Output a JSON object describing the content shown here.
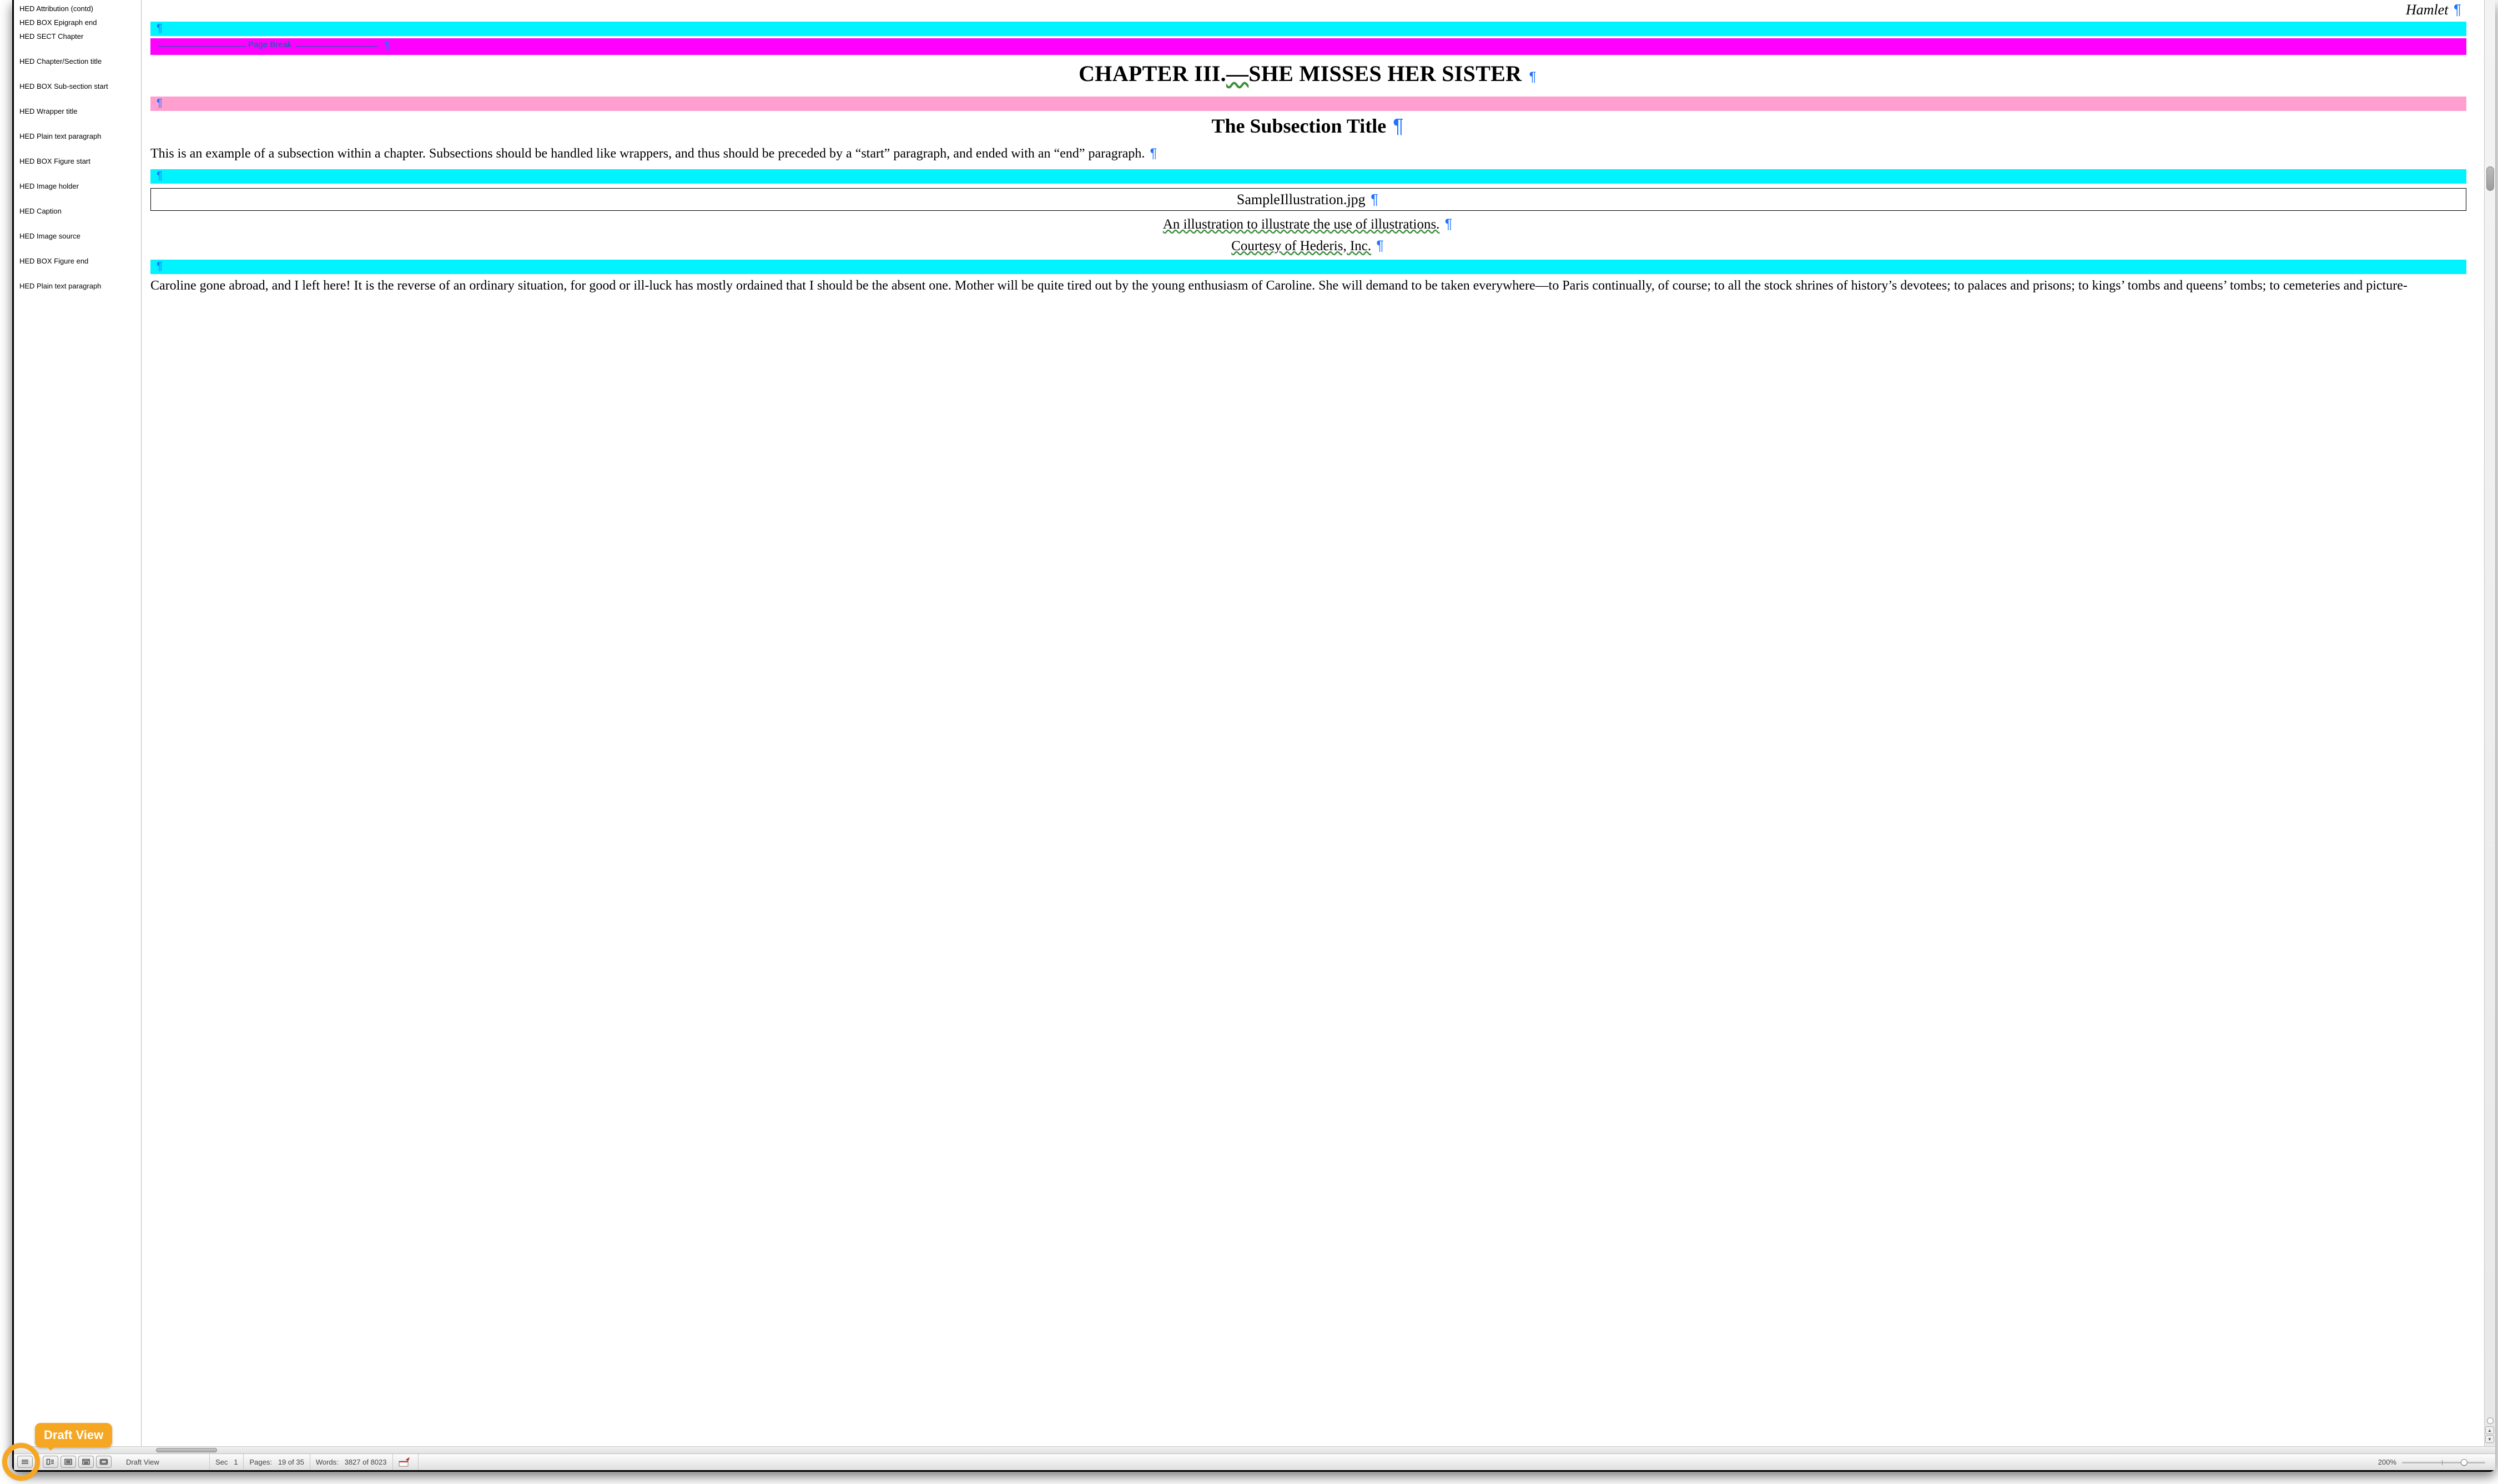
{
  "callout": {
    "label": "Draft View"
  },
  "stylepane": {
    "items": [
      {
        "label": "HED Attribution (contd)",
        "short": true
      },
      {
        "label": "HED BOX Epigraph end",
        "short": true
      },
      {
        "label": "HED SECT Chapter",
        "short": false
      },
      {
        "label": "HED Chapter/Section title",
        "short": false
      },
      {
        "label": "HED BOX Sub-section start",
        "short": false
      },
      {
        "label": "HED Wrapper title",
        "short": false
      },
      {
        "label": "HED Plain text paragraph",
        "short": false
      },
      {
        "label": "HED BOX Figure start",
        "short": false
      },
      {
        "label": "HED Image holder",
        "short": false
      },
      {
        "label": "HED Caption",
        "short": false
      },
      {
        "label": "HED Image source",
        "short": false
      },
      {
        "label": "HED BOX Figure end",
        "short": false
      },
      {
        "label": "HED Plain text paragraph",
        "short": false
      }
    ]
  },
  "doc": {
    "running_head": "Hamlet",
    "page_break_label": "Page Break",
    "chapter_title_prefix": "CHAPTER III.",
    "chapter_title_dash": "—",
    "chapter_title_rest": "SHE MISSES HER SISTER",
    "subsection_title": "The Subsection Title",
    "body1": "This is an example of a subsection within a chapter. Subsections should be handled like wrappers, and thus should be preceded by a “start” paragraph, and ended with an “end” paragraph. ",
    "image_filename": "SampleIllustration.jpg",
    "caption": "An illustration to illustrate the use of illustrations.",
    "source": "Courtesy of Hederis, Inc.",
    "body2": "Caroline gone abroad, and I left here!  It is the reverse of an ordinary situation, for good or ill-luck has mostly ordained that I should be the absent one.  Mother will be quite tired out by the young enthusiasm of Caroline.  She will demand to be taken everywhere—to Paris continually, of course; to all the stock shrines of history’s devotees; to palaces and prisons; to kings’ tombs and queens’ tombs; to cemeteries and picture-"
  },
  "status": {
    "view_label": "Draft View",
    "sec_label": "Sec",
    "sec_value": "1",
    "pages_label": "Pages:",
    "pages_value": "19 of 35",
    "words_label": "Words:",
    "words_value": "3827 of 8023",
    "zoom_value": "200%"
  },
  "colors": {
    "cyan": "#00f3ff",
    "magenta": "#ff00ff",
    "pink": "#ff9fd0",
    "callout": "#f5a623",
    "pilcrow": "#1f74ff"
  }
}
